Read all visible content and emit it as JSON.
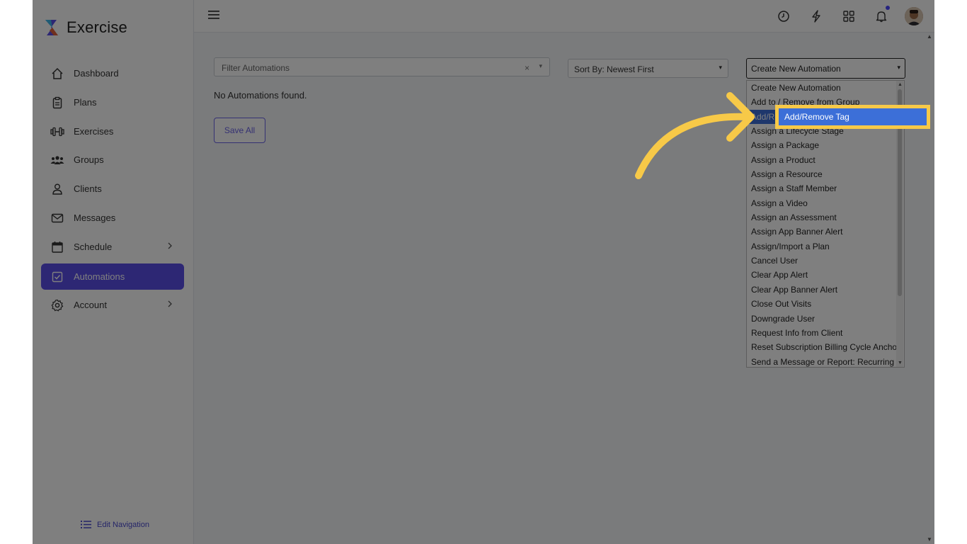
{
  "app": {
    "name": "Exercise"
  },
  "sidebar": {
    "items": [
      {
        "label": "Dashboard",
        "icon": "home-icon"
      },
      {
        "label": "Plans",
        "icon": "clipboard-icon"
      },
      {
        "label": "Exercises",
        "icon": "dumbbell-icon"
      },
      {
        "label": "Groups",
        "icon": "users-icon"
      },
      {
        "label": "Clients",
        "icon": "user-icon"
      },
      {
        "label": "Messages",
        "icon": "mail-icon"
      },
      {
        "label": "Schedule",
        "icon": "calendar-icon"
      },
      {
        "label": "Automations",
        "icon": "checkbox-icon",
        "active": true
      },
      {
        "label": "Account",
        "icon": "gear-icon"
      }
    ],
    "edit_navigation": "Edit Navigation"
  },
  "toolbar": {
    "filter_placeholder": "Filter Automations",
    "clear": "×",
    "caret": "▾",
    "sort_label": "Sort By: Newest First",
    "create_label": "Create New Automation"
  },
  "main": {
    "empty_message": "No Automations found.",
    "save_all": "Save All"
  },
  "dropdown": {
    "options": [
      "Create New Automation",
      "Add to / Remove from Group",
      "Add/Remove Tag",
      "Assign a Lifecycle Stage",
      "Assign a Package",
      "Assign a Product",
      "Assign a Resource",
      "Assign a Staff Member",
      "Assign a Video",
      "Assign an Assessment",
      "Assign App Banner Alert",
      "Assign/Import a Plan",
      "Cancel User",
      "Clear App Alert",
      "Clear App Banner Alert",
      "Close Out Visits",
      "Downgrade User",
      "Request Info from Client",
      "Reset Subscription Billing Cycle Anchor",
      "Send a Message or Report: Recurring"
    ],
    "highlighted": "Add/Remove Tag"
  },
  "colors": {
    "accent": "#5b4ee8",
    "highlight_border": "#f7c948",
    "selected_option": "#3c6fd8",
    "overlay": "rgba(0,0,0,0.5)"
  }
}
